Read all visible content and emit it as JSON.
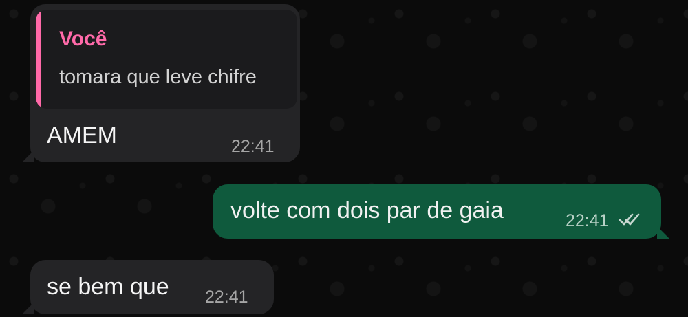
{
  "chat": {
    "messages": [
      {
        "direction": "incoming",
        "reply": {
          "author": "Você",
          "text": "tomara que leve chifre"
        },
        "text": "AMEM",
        "time": "22:41"
      },
      {
        "direction": "outgoing",
        "text": "volte com dois par de gaia",
        "time": "22:41",
        "status_icon": "double-check-icon"
      },
      {
        "direction": "incoming",
        "text": "se bem que",
        "time": "22:41"
      }
    ]
  },
  "colors": {
    "background": "#0b0b0b",
    "incoming_bubble": "#242426",
    "outgoing_bubble": "#0f5a3d",
    "quote_accent": "#ff6aa9"
  }
}
